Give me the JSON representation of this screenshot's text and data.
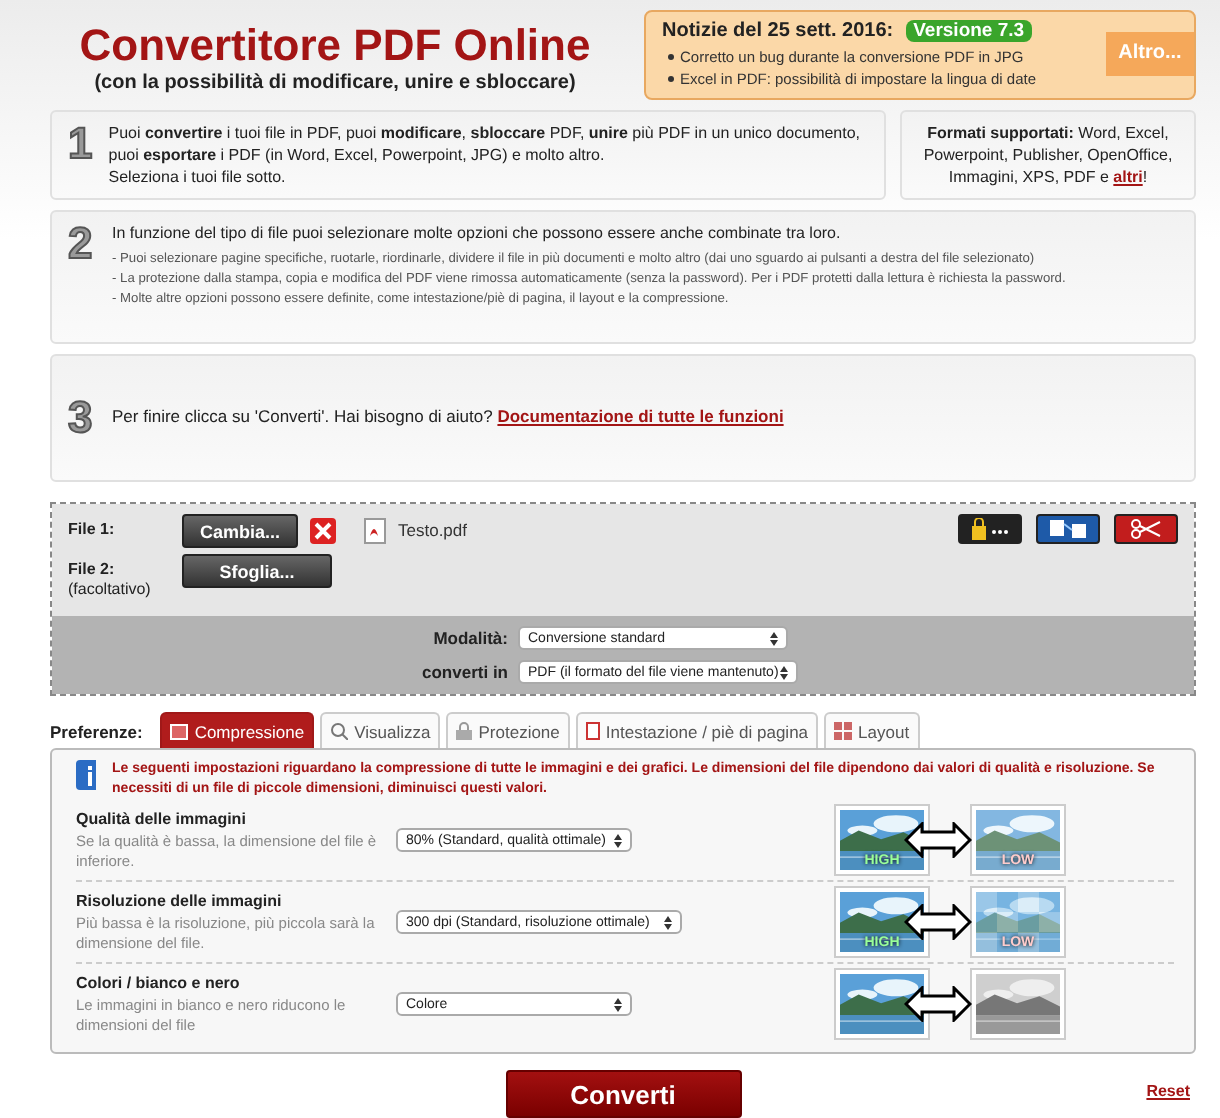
{
  "header": {
    "title": "Convertitore PDF Online",
    "subtitle": "(con la possibilità di modificare, unire e sbloccare)"
  },
  "news": {
    "title": "Notizie del 25 sett. 2016:",
    "version": "Versione 7.3",
    "items": [
      "Corretto un bug durante la conversione PDF in JPG",
      "Excel in PDF: possibilità di impostare la lingua di date"
    ],
    "more_button": "Altro..."
  },
  "step1": {
    "number": "1",
    "text": "Puoi **convertire** i tuoi file in PDF, puoi **modificare**, **sbloccare** PDF, **unire** più PDF in un unico documento, puoi **esportare** i PDF (in Word, Excel, Powerpoint, JPG) e molto altro.",
    "text_2": "Seleziona i tuoi file sotto.",
    "formats": "**Formati supportati:** Word, Excel, Powerpoint, Publisher, OpenOffice, Immagini, XPS, PDF e",
    "formats_link": "altri",
    "formats_end": "!"
  },
  "step2": {
    "number": "2",
    "intro": "In funzione del tipo di file puoi selezionare molte opzioni che possono essere anche combinate tra loro.",
    "bullets": [
      "- Puoi selezionare pagine specifiche, ruotarle, riordinarle, dividere il file in più documenti e molto altro (dai uno sguardo ai pulsanti a destra del file selezionato)",
      "- La protezione dalla stampa, copia e modifica del PDF viene rimossa automaticamente (senza la password). Per i PDF protetti dalla lettura è richiesta la password.",
      "- Molte altre opzioni possono essere definite, come intestazione/piè di pagina, il layout e la compressione."
    ]
  },
  "step3": {
    "number": "3",
    "text": "Per finire clicca su 'Converti'. Hai bisogno di aiuto?",
    "link": "Documentazione di tutte le funzioni"
  },
  "upload": {
    "files": [
      {
        "label": "File 1:",
        "button": "Cambia...",
        "filename": "Testo.pdf"
      },
      {
        "label": "File 2:",
        "sublabel": "(facoltativo)",
        "button": "Sfoglia..."
      }
    ],
    "options": [
      {
        "label": "Modalità:",
        "value": "Conversione standard"
      },
      {
        "label": "converti in",
        "value": "PDF (il formato del file viene mantenuto)"
      }
    ]
  },
  "preferences": {
    "label": "Preferenze:",
    "tabs": [
      {
        "label": "Compressione",
        "selected": true
      },
      {
        "label": "Visualizza",
        "selected": false
      },
      {
        "label": "Protezione",
        "selected": false
      },
      {
        "label": "Intestazione / piè di pagina",
        "selected": false
      },
      {
        "label": "Layout",
        "selected": false
      }
    ],
    "info": "Le seguenti impostazioni riguardano la compressione di tutte le immagini e dei grafici. Le dimensioni del file dipendono dai valori di qualità e risoluzione. Se necessiti di un file di piccole dimensioni, diminuisci questi valori.",
    "settings": [
      {
        "title": "Qualità delle immagini",
        "description": "Se la qualità è bassa, la dimensione del file è inferiore.",
        "value": "80% (Standard, qualità ottimale)",
        "kind": "quality",
        "high_label": "HIGH",
        "low_label": "LOW"
      },
      {
        "title": "Risoluzione delle immagini",
        "description": "Più bassa è la risoluzione, più piccola sarà la dimensione del file.",
        "value": "300 dpi (Standard, risoluzione ottimale)",
        "kind": "resolution",
        "high_label": "HIGH",
        "low_label": "LOW"
      },
      {
        "title": "Colori / bianco e nero",
        "description": "Le immagini in bianco e nero riducono le dimensioni del file",
        "value": "Colore",
        "kind": "gray"
      }
    ]
  },
  "convert_button": "Converti",
  "reset_link": "Reset"
}
